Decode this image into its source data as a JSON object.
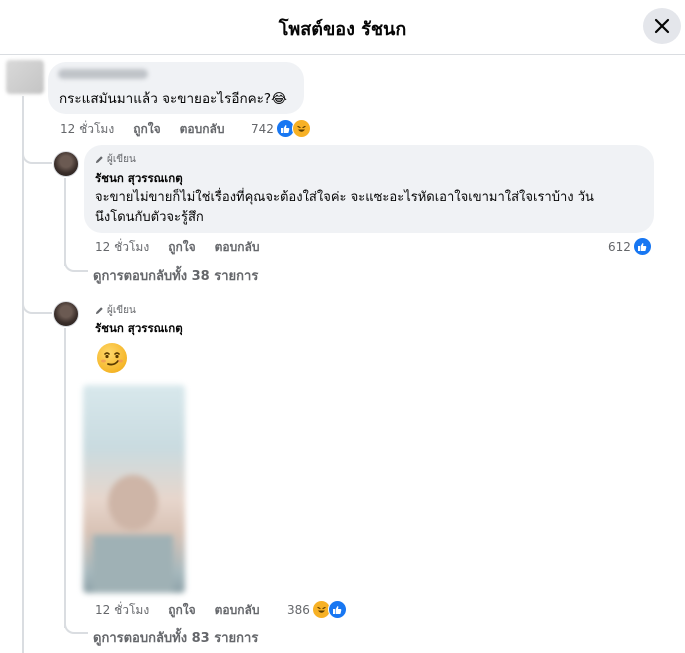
{
  "header": {
    "title": "โพสต์ของ รัชนก",
    "close_icon": "close-icon"
  },
  "comments": [
    {
      "author_name": "",
      "text": "กระแสมันมาแล้ว จะขายอะไรอีกคะ?😂",
      "time": "12 ชั่วโมง",
      "like_label": "ถูกใจ",
      "reply_label": "ตอบกลับ",
      "reaction_count": "742",
      "reaction_icons": [
        "like-icon",
        "haha-icon"
      ]
    }
  ],
  "replies": [
    {
      "author_badge": "ผู้เขียน",
      "author_name": "รัชนก สุวรรณเกตุ",
      "text_line1": "จะขายไม่ขายก็ไม่ใช่เรื่องที่คุณจะต้องใส่ใจค่ะ จะแซะอะไรหัดเอาใจเขามาใส่ใจเราบ้าง วัน",
      "text_line2": "นึงโดนกับตัวจะรู้สึก",
      "time": "12 ชั่วโมง",
      "like_label": "ถูกใจ",
      "reply_label": "ตอบกลับ",
      "reaction_count": "612",
      "reaction_icons": [
        "like-icon"
      ],
      "view_replies": "ดูการตอบกลับทั้ง 38 รายการ"
    },
    {
      "author_badge": "ผู้เขียน",
      "author_name": "รัชนก สุวรรณเกตุ",
      "sticker": "smirk-emoji",
      "attachment": "blurred-photo",
      "time": "12 ชั่วโมง",
      "like_label": "ถูกใจ",
      "reply_label": "ตอบกลับ",
      "reaction_count": "386",
      "reaction_icons": [
        "haha-icon",
        "like-icon"
      ],
      "view_replies": "ดูการตอบกลับทั้ง 83 รายการ"
    }
  ],
  "colors": {
    "accent": "#1877f2",
    "bubble": "#f0f2f5",
    "meta_text": "#65676b",
    "haha": "#f7b125"
  }
}
